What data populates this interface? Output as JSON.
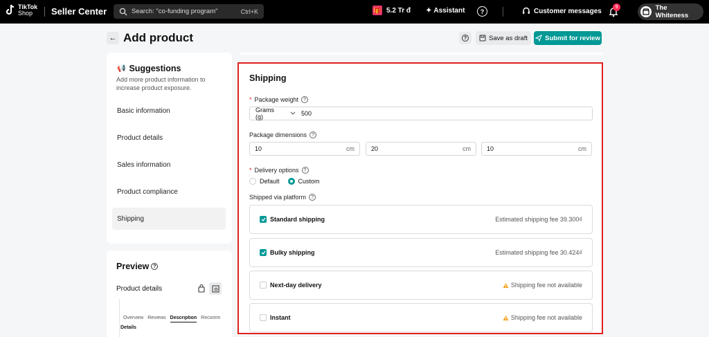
{
  "topbar": {
    "logo_line1": "TikTok",
    "logo_line2": "Shop",
    "app_name": "Seller Center",
    "search_placeholder": "Search: \"co-funding program\"",
    "search_shortcut": "Ctrl+K",
    "reward_value": "5.2 Tr đ",
    "assistant_label": "Assistant",
    "help_glyph": "?",
    "messages_label": "Customer messages",
    "notification_count": "9",
    "account_name": "The Whiteness"
  },
  "header": {
    "back_glyph": "←",
    "title": "Add product",
    "help_glyph": "?",
    "save_draft_label": "Save as draft",
    "submit_label": "Submit for review"
  },
  "suggestions": {
    "title": "Suggestions",
    "description": "Add more product information to increase product exposure.",
    "items": [
      {
        "label": "Basic information"
      },
      {
        "label": "Product details"
      },
      {
        "label": "Sales information"
      },
      {
        "label": "Product compliance"
      },
      {
        "label": "Shipping"
      }
    ],
    "active_index": 4
  },
  "preview": {
    "title": "Preview",
    "help_glyph": "?",
    "product_details_label": "Product details",
    "tabs": [
      "Overview",
      "Reviews",
      "Description",
      "Recommen"
    ],
    "active_tab": 2,
    "details_label": "Details"
  },
  "shipping": {
    "title": "Shipping",
    "package_weight": {
      "label": "Package weight",
      "required": "*",
      "help_glyph": "?",
      "unit": "Grams (g)",
      "value": "500"
    },
    "package_dimensions": {
      "label": "Package dimensions",
      "help_glyph": "?",
      "fields": [
        {
          "value": "10",
          "unit": "cm"
        },
        {
          "value": "20",
          "unit": "cm"
        },
        {
          "value": "10",
          "unit": "cm"
        }
      ]
    },
    "delivery_options": {
      "label": "Delivery options",
      "required": "*",
      "help_glyph": "?",
      "options": [
        {
          "label": "Default",
          "selected": false
        },
        {
          "label": "Custom",
          "selected": true
        }
      ]
    },
    "shipped_via": {
      "label": "Shipped via platform",
      "help_glyph": "?",
      "options": [
        {
          "name": "Standard shipping",
          "checked": true,
          "fee": "Estimated shipping fee 39.300₫",
          "warning": false
        },
        {
          "name": "Bulky shipping",
          "checked": true,
          "fee": "Estimated shipping fee 30.424₫",
          "warning": false
        },
        {
          "name": "Next-day delivery",
          "checked": false,
          "fee": "Shipping fee not available",
          "warning": true
        },
        {
          "name": "Instant",
          "checked": false,
          "fee": "Shipping fee not available",
          "warning": true
        }
      ]
    }
  },
  "colors": {
    "accent": "#009995",
    "highlight_border": "#e0201e",
    "warning": "#f5a623"
  }
}
